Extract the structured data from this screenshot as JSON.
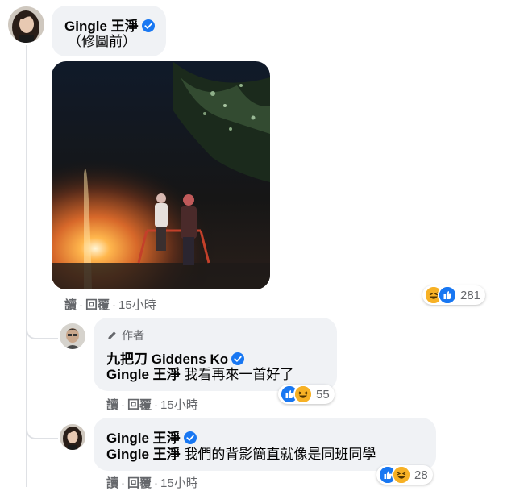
{
  "comments": [
    {
      "author": "Gingle 王淨",
      "text": "（修圖前）",
      "actions": {
        "read": "讀",
        "reply": "回覆",
        "time": "15小時"
      },
      "reactions": {
        "icons": [
          "haha-icon",
          "like-icon"
        ],
        "count": "281"
      }
    },
    {
      "author_badge": "作者",
      "author": "九把刀 Giddens Ko",
      "mention": "Gingle 王淨",
      "text": "我看再來一首好了",
      "actions": {
        "read": "讀",
        "reply": "回覆",
        "time": "15小時"
      },
      "reactions": {
        "icons": [
          "like-icon",
          "haha-icon"
        ],
        "count": "55"
      }
    },
    {
      "author": "Gingle 王淨",
      "mention": "Gingle 王淨",
      "text": "我們的背影簡直就像是同班同學",
      "actions": {
        "read": "讀",
        "reply": "回覆",
        "time": "15小時"
      },
      "reactions": {
        "icons": [
          "like-icon",
          "haha-icon"
        ],
        "count": "28"
      }
    }
  ],
  "colors": {
    "bubble": "#f0f2f5",
    "meta_text": "#65676b",
    "verified": "#1877f2",
    "like": "#1877f2",
    "haha": "#f7b125"
  }
}
